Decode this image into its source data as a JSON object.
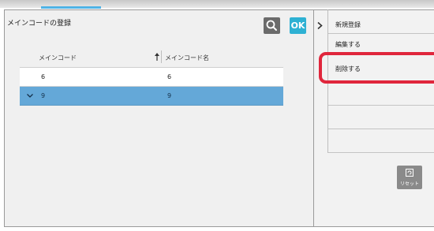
{
  "header": {
    "title": "メインコードの登録",
    "ok_label": "OK",
    "search_icon": "search-icon",
    "accent_color": "#2eb1d3"
  },
  "table": {
    "columns": [
      "メインコード",
      "メインコード名"
    ],
    "rows": [
      {
        "code": "6",
        "name": "6",
        "selected": false
      },
      {
        "code": "9",
        "name": "9",
        "selected": true
      }
    ],
    "selected_row_color": "#64a8d8"
  },
  "side_menu": {
    "items": [
      "新規登録",
      "編集する",
      "削除する",
      "",
      "",
      ""
    ],
    "highlight_color": "#e0263c",
    "reset_label": "リセット"
  }
}
